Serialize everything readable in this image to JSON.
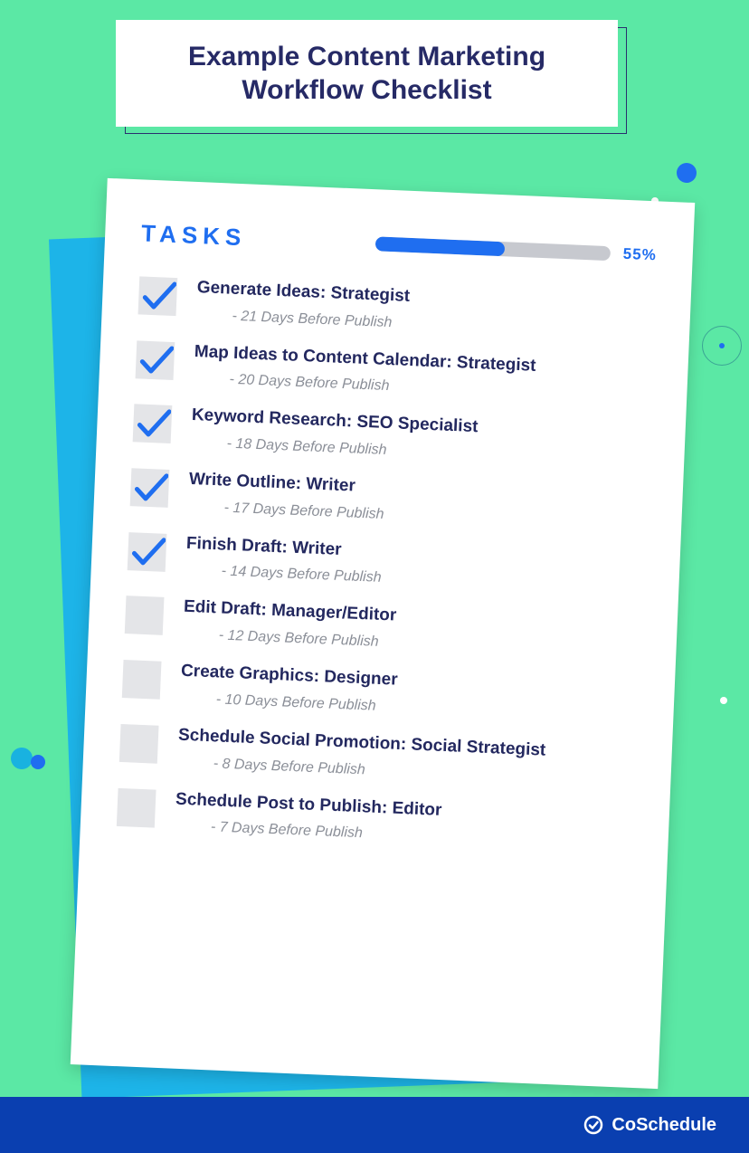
{
  "title": "Example Content Marketing Workflow Checklist",
  "tasks_heading": "TASKS",
  "progress": {
    "percent": 55,
    "label": "55%"
  },
  "tasks": [
    {
      "title": "Generate Ideas:  Strategist",
      "sub": "- 21 Days Before Publish",
      "checked": true
    },
    {
      "title": "Map Ideas to Content Calendar:  Strategist",
      "sub": "- 20 Days Before Publish",
      "checked": true
    },
    {
      "title": "Keyword Research:  SEO Specialist",
      "sub": "- 18 Days Before Publish",
      "checked": true
    },
    {
      "title": "Write Outline:  Writer",
      "sub": "- 17 Days Before Publish",
      "checked": true
    },
    {
      "title": "Finish Draft:  Writer",
      "sub": "- 14 Days Before Publish",
      "checked": true
    },
    {
      "title": "Edit Draft:  Manager/Editor",
      "sub": "- 12 Days Before Publish",
      "checked": false
    },
    {
      "title": "Create Graphics:  Designer",
      "sub": "- 10 Days Before Publish",
      "checked": false
    },
    {
      "title": "Schedule Social Promotion:  Social Strategist",
      "sub": "- 8 Days Before Publish",
      "checked": false
    },
    {
      "title": "Schedule Post to Publish: Editor",
      "sub": "- 7 Days Before Publish",
      "checked": false
    }
  ],
  "footer": {
    "brand": "CoSchedule"
  }
}
